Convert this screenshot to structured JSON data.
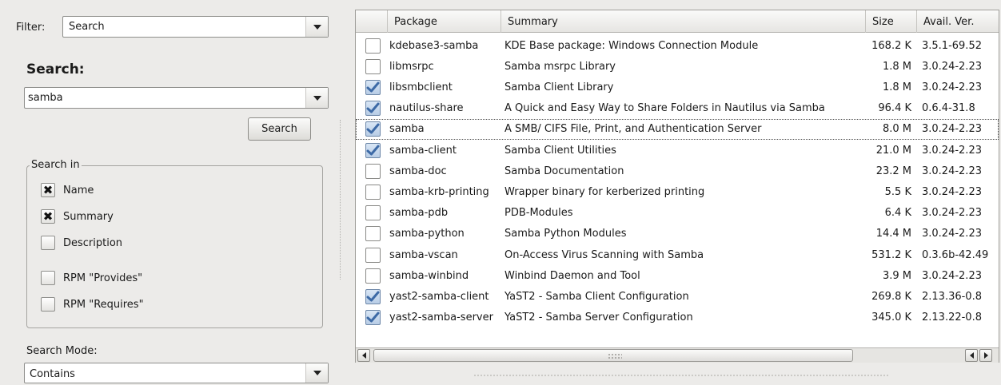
{
  "filter": {
    "label": "Filter:",
    "value": "Search"
  },
  "search": {
    "heading": "Search:",
    "value": "samba",
    "button_label": "Search"
  },
  "search_in": {
    "title": "Search in",
    "options": [
      {
        "label": "Name",
        "checked": true
      },
      {
        "label": "Summary",
        "checked": true
      },
      {
        "label": "Description",
        "checked": false
      },
      {
        "label": "RPM \"Provides\"",
        "checked": false
      },
      {
        "label": "RPM \"Requires\"",
        "checked": false
      }
    ]
  },
  "search_mode": {
    "label": "Search Mode:",
    "value": "Contains"
  },
  "table": {
    "headers": [
      "Package",
      "Summary",
      "Size",
      "Avail. Ver."
    ],
    "rows": [
      {
        "checked": false,
        "package": "kdebase3-samba",
        "summary": "KDE Base package: Windows Connection Module",
        "size": "168.2 K",
        "version": "3.5.1-69.52"
      },
      {
        "checked": false,
        "package": "libmsrpc",
        "summary": "Samba msrpc Library",
        "size": "1.8 M",
        "version": "3.0.24-2.23"
      },
      {
        "checked": true,
        "package": "libsmbclient",
        "summary": "Samba Client Library",
        "size": "1.8 M",
        "version": "3.0.24-2.23"
      },
      {
        "checked": true,
        "package": "nautilus-share",
        "summary": "A Quick and Easy Way to Share Folders in Nautilus via Samba",
        "size": "96.4 K",
        "version": "0.6.4-31.8"
      },
      {
        "checked": true,
        "package": "samba",
        "summary": "A SMB/ CIFS File, Print, and Authentication Server",
        "size": "8.0 M",
        "version": "3.0.24-2.23",
        "focused": true
      },
      {
        "checked": true,
        "package": "samba-client",
        "summary": "Samba Client Utilities",
        "size": "21.0 M",
        "version": "3.0.24-2.23"
      },
      {
        "checked": false,
        "package": "samba-doc",
        "summary": "Samba Documentation",
        "size": "23.2 M",
        "version": "3.0.24-2.23"
      },
      {
        "checked": false,
        "package": "samba-krb-printing",
        "summary": "Wrapper binary for kerberized printing",
        "size": "5.5 K",
        "version": "3.0.24-2.23"
      },
      {
        "checked": false,
        "package": "samba-pdb",
        "summary": "PDB-Modules",
        "size": "6.4 K",
        "version": "3.0.24-2.23"
      },
      {
        "checked": false,
        "package": "samba-python",
        "summary": "Samba Python Modules",
        "size": "14.4 M",
        "version": "3.0.24-2.23"
      },
      {
        "checked": false,
        "package": "samba-vscan",
        "summary": "On-Access Virus Scanning with Samba",
        "size": "531.2 K",
        "version": "0.3.6b-42.49"
      },
      {
        "checked": false,
        "package": "samba-winbind",
        "summary": "Winbind Daemon and Tool",
        "size": "3.9 M",
        "version": "3.0.24-2.23"
      },
      {
        "checked": true,
        "package": "yast2-samba-client",
        "summary": "YaST2 - Samba Client Configuration",
        "size": "269.8 K",
        "version": "2.13.36-0.8"
      },
      {
        "checked": true,
        "package": "yast2-samba-server",
        "summary": "YaST2 - Samba Server Configuration",
        "size": "345.0 K",
        "version": "2.13.22-0.8"
      }
    ]
  },
  "colors": {
    "check_fill": "#b8cde6",
    "check_mark": "#3d6aa6",
    "background": "#ecebe9"
  },
  "icons": {
    "checked": "check-icon",
    "dropdown": "chevron-down-icon",
    "scroll_left": "arrow-left-icon",
    "scroll_right": "arrow-right-icon"
  }
}
